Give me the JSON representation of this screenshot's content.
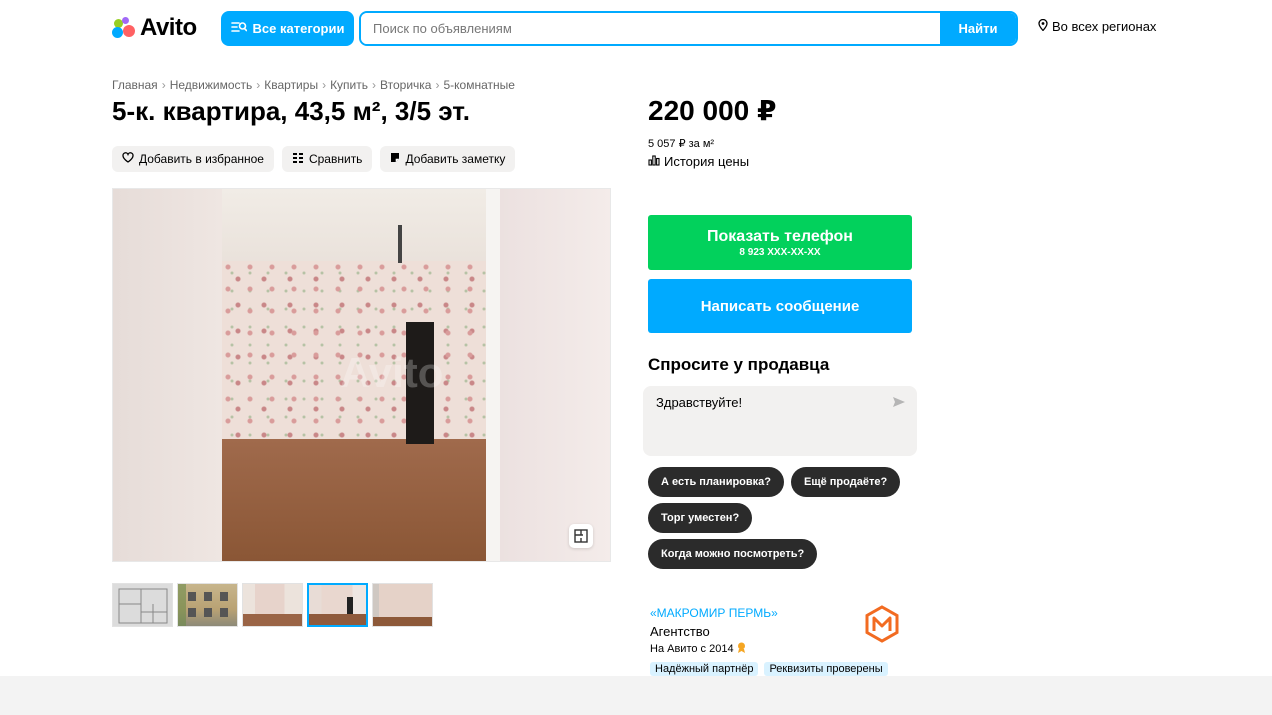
{
  "header": {
    "logo_text": "Avito",
    "all_categories_label": "Все категории",
    "search_placeholder": "Поиск по объявлениям",
    "search_button_label": "Найти",
    "region_label": "Во всех регионах"
  },
  "breadcrumb": [
    "Главная",
    "Недвижимость",
    "Квартиры",
    "Купить",
    "Вторичка",
    "5-комнатные"
  ],
  "listing": {
    "title": "5-к. квартира, 43,5 м², 3/5 эт.",
    "actions": {
      "favorite": "Добавить в избранное",
      "compare": "Сравнить",
      "note": "Добавить заметку"
    },
    "photo_watermark": "Avito"
  },
  "pricing": {
    "price": "220 000 ₽",
    "price_per_sqm": "5 057 ₽ за м²",
    "price_history": "История цены"
  },
  "contact": {
    "show_phone_label": "Показать телефон",
    "phone_masked": "8 923 XXX-XX-XX",
    "message_label": "Написать сообщение"
  },
  "ask_seller": {
    "title": "Спросите у продавца",
    "message_value": "Здравствуйте!",
    "quick_questions": [
      "А есть планировка?",
      "Ещё продаёте?",
      "Торг уместен?",
      "Когда можно посмотреть?"
    ]
  },
  "seller": {
    "name": "«МАКРОМИР ПЕРМЬ»",
    "type": "Агентство",
    "since": "На Авито с 2014",
    "badges": [
      "Надёжный партнёр",
      "Реквизиты проверены"
    ]
  },
  "colors": {
    "accent_blue": "#00aaff",
    "phone_green": "#02d15c",
    "chip_dark": "#2b2b2b",
    "seller_logo_orange": "#f26b21"
  }
}
